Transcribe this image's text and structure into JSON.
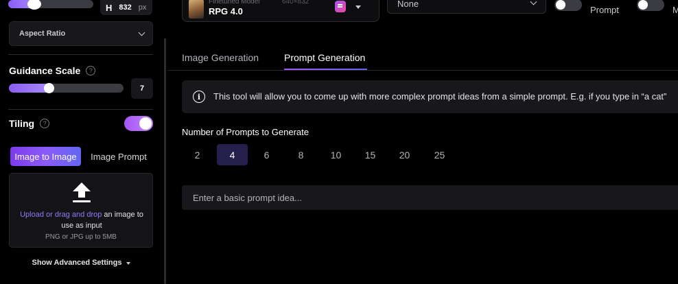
{
  "sidebar": {
    "dimension": {
      "letter": "H",
      "value": "832",
      "unit": "px",
      "slider_fraction": 0.34
    },
    "aspect_ratio_label": "Aspect Ratio",
    "guidance_scale": {
      "label": "Guidance Scale",
      "help": "?",
      "value": "7",
      "fraction": 0.32
    },
    "tiling": {
      "label": "Tiling",
      "help": "?",
      "enabled": true
    },
    "mode_tabs": [
      "Image to Image",
      "Image Prompt"
    ],
    "upload": {
      "link_text": "Upload or drag and drop",
      "text_rest": " an image to use as input",
      "formats": "PNG or JPG up to 5MB"
    },
    "advanced_label": "Show Advanced Settings"
  },
  "topbar": {
    "model": {
      "label": "Finetuned Model",
      "dims": "640×832",
      "name": "RPG 4.0"
    },
    "preset_value": "None",
    "toggle1_label": "Prompt",
    "toggle2_label": "M"
  },
  "tabs": [
    {
      "label": "Image Generation",
      "active": false
    },
    {
      "label": "Prompt Generation",
      "active": true
    }
  ],
  "info": {
    "icon": "i",
    "text": "This tool will allow you to come up with more complex prompt ideas from a simple prompt. E.g. if you type in “a cat”"
  },
  "prompts_count": {
    "label": "Number of Prompts to Generate",
    "options": [
      "2",
      "4",
      "6",
      "8",
      "10",
      "15",
      "20",
      "25"
    ],
    "selected": "4"
  },
  "prompt_input": {
    "placeholder": "Enter a basic prompt idea..."
  },
  "colors": {
    "accent": "#8b5cf6",
    "selected_bg": "#241f4b",
    "panel": "#18181c"
  }
}
